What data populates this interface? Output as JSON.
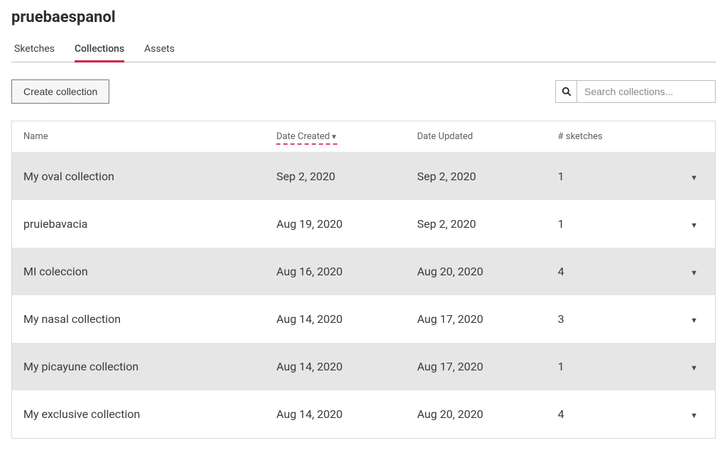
{
  "page": {
    "title": "pruebaespanol"
  },
  "tabs": {
    "items": [
      {
        "label": "Sketches"
      },
      {
        "label": "Collections"
      },
      {
        "label": "Assets"
      }
    ],
    "activeIndex": 1
  },
  "toolbar": {
    "createLabel": "Create collection",
    "search": {
      "placeholder": "Search collections..."
    }
  },
  "table": {
    "headers": {
      "name": "Name",
      "created": "Date Created",
      "updated": "Date Updated",
      "sketches": "# sketches"
    },
    "sortIndicator": "▼",
    "rows": [
      {
        "name": "My oval collection",
        "created": "Sep 2, 2020",
        "updated": "Sep 2, 2020",
        "sketches": "1"
      },
      {
        "name": "pruiebavacia",
        "created": "Aug 19, 2020",
        "updated": "Sep 2, 2020",
        "sketches": "1"
      },
      {
        "name": "MI coleccion",
        "created": "Aug 16, 2020",
        "updated": "Aug 20, 2020",
        "sketches": "4"
      },
      {
        "name": "My nasal collection",
        "created": "Aug 14, 2020",
        "updated": "Aug 17, 2020",
        "sketches": "3"
      },
      {
        "name": "My picayune collection",
        "created": "Aug 14, 2020",
        "updated": "Aug 17, 2020",
        "sketches": "1"
      },
      {
        "name": "My exclusive collection",
        "created": "Aug 14, 2020",
        "updated": "Aug 20, 2020",
        "sketches": "4"
      }
    ]
  }
}
